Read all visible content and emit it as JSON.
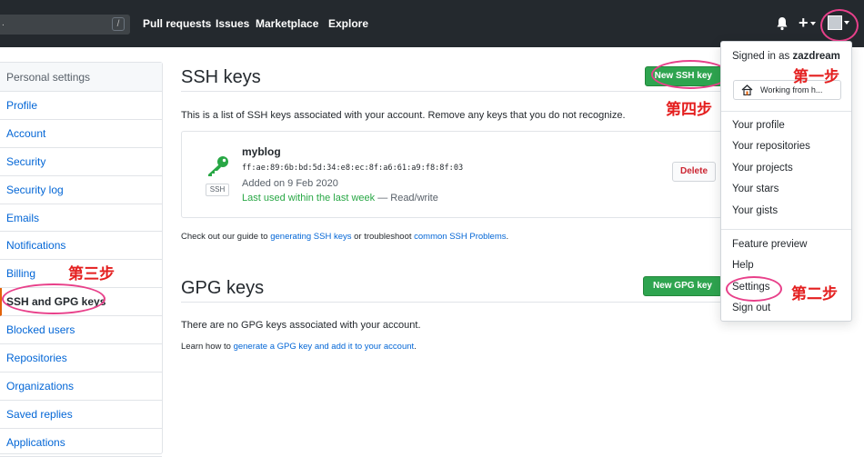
{
  "header": {
    "nav": [
      "Pull requests",
      "Issues",
      "Marketplace",
      "Explore"
    ],
    "search_slash": "/"
  },
  "sidebar": {
    "heading": "Personal settings",
    "items": [
      "Profile",
      "Account",
      "Security",
      "Security log",
      "Emails",
      "Notifications",
      "Billing",
      "SSH and GPG keys",
      "Blocked users",
      "Repositories",
      "Organizations",
      "Saved replies",
      "Applications"
    ],
    "active": "SSH and GPG keys"
  },
  "ssh": {
    "title": "SSH keys",
    "new_button": "New SSH key",
    "description": "This is a list of SSH keys associated with your account. Remove any keys that you do not recognize.",
    "key": {
      "name": "myblog",
      "fingerprint": "ff:ae:89:6b:bd:5d:34:e8:ec:8f:a6:61:a9:f8:8f:03",
      "added": "Added on 9 Feb 2020",
      "last_used": "Last used within the last week",
      "access": " — Read/write",
      "badge": "SSH",
      "delete_button": "Delete"
    },
    "guide_prefix": "Check out our guide to ",
    "guide_link1": "generating SSH keys",
    "guide_middle": " or troubleshoot ",
    "guide_link2": "common SSH Problems",
    "guide_suffix": "."
  },
  "gpg": {
    "title": "GPG keys",
    "new_button": "New GPG key",
    "empty": "There are no GPG keys associated with your account.",
    "learn_prefix": "Learn how to ",
    "learn_link": "generate a GPG key and add it to your account",
    "learn_suffix": "."
  },
  "dropdown": {
    "signed_in_prefix": "Signed in as ",
    "username": "zazdream",
    "status": "Working from h...",
    "items_group1": [
      "Your profile",
      "Your repositories",
      "Your projects",
      "Your stars",
      "Your gists"
    ],
    "items_group2": [
      "Feature preview",
      "Help",
      "Settings",
      "Sign out"
    ]
  },
  "annotations": {
    "step1": "第一步",
    "step2": "第二步",
    "step3": "第三步",
    "step4": "第四步"
  },
  "colors": {
    "header_bg": "#24292e",
    "link": "#0366d6",
    "green": "#2ea44f",
    "annotation_red": "#e41f1f",
    "circle_pink": "#e8408a",
    "delete_red": "#cb2431"
  }
}
